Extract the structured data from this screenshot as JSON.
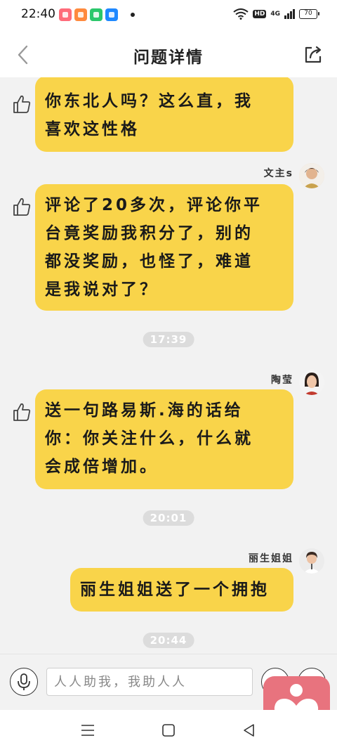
{
  "status_bar": {
    "time": "22:40",
    "network": "4G",
    "hd": "HD",
    "battery": "70"
  },
  "header": {
    "title": "问题详情"
  },
  "messages": [
    {
      "text": "你东北人吗？这么直，我喜欢这性格",
      "lines": [
        "你东北人吗？这么直，我",
        "喜欢这性格"
      ]
    },
    {
      "sender": "文主s",
      "text": "评论了20多次，评论你平台竟奖励我积分了，别的都没奖励，也怪了，难道是我说对了？",
      "lines": [
        "评论了20多次，评论你平",
        "台竟奖励我积分了，别的",
        "都没奖励，也怪了，难道",
        "是我说对了？"
      ]
    },
    {
      "time": "17:39"
    },
    {
      "sender": "陶莹",
      "text": "送一句路易斯.海的话给你：你关注什么，什么就会成倍增加。",
      "lines": [
        "送一句路易斯.海的话给",
        "你：你关注什么，什么就",
        "会成倍增加。"
      ]
    },
    {
      "time": "20:01"
    },
    {
      "sender": "丽生姐姐",
      "text": "丽生姐姐送了一个拥抱",
      "lines": [
        "丽生姐姐送了一个拥抱"
      ]
    },
    {
      "time": "20:44"
    }
  ],
  "input_bar": {
    "placeholder": "人人助我，我助人人"
  },
  "colors": {
    "bubble": "#f9d44a",
    "background": "#f2f2f2",
    "timestamp": "#dcdcdc",
    "float_logo": "#e8737e"
  }
}
